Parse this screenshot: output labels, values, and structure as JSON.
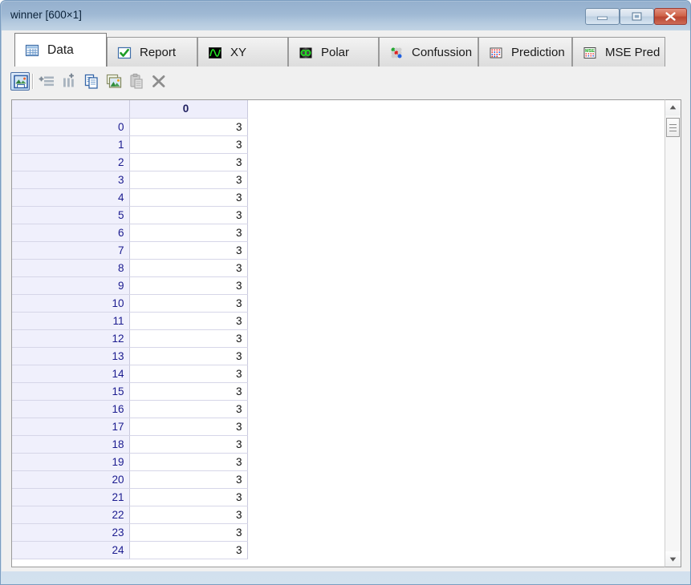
{
  "window": {
    "title": "winner [600×1]",
    "controls": {
      "minimize": "Minimize",
      "maximize": "Maximize",
      "close": "Close"
    }
  },
  "tabs": [
    {
      "label": "Data",
      "icon": "table-grid-icon",
      "active": true
    },
    {
      "label": "Report",
      "icon": "green-check-icon",
      "active": false
    },
    {
      "label": "XY",
      "icon": "waveform-plot-icon",
      "active": false
    },
    {
      "label": "Polar",
      "icon": "polar-plot-icon",
      "active": false
    },
    {
      "label": "Confussion",
      "icon": "confusion-matrix-icon",
      "active": false
    },
    {
      "label": "Prediction",
      "icon": "prediction-grid-icon",
      "active": false
    },
    {
      "label": "MSE Pred",
      "icon": "mse-grid-icon",
      "active": false
    }
  ],
  "toolbar": [
    {
      "name": "save-image-button",
      "icon": "image-save-icon",
      "enabled": true,
      "selected": true
    },
    {
      "name": "add-row-button",
      "icon": "add-row-icon",
      "enabled": true,
      "selected": false
    },
    {
      "name": "add-column-button",
      "icon": "add-column-icon",
      "enabled": true,
      "selected": false
    },
    {
      "name": "copy-button",
      "icon": "copy-icon",
      "enabled": true,
      "selected": false
    },
    {
      "name": "paste-image-button",
      "icon": "paste-image-icon",
      "enabled": true,
      "selected": false
    },
    {
      "name": "paste-button",
      "icon": "clipboard-paste-icon",
      "enabled": false,
      "selected": false
    },
    {
      "name": "delete-button",
      "icon": "delete-x-icon",
      "enabled": true,
      "selected": false
    }
  ],
  "table": {
    "corner_label": "",
    "columns": [
      "0"
    ],
    "rows": [
      {
        "header": "0",
        "values": [
          "3"
        ]
      },
      {
        "header": "1",
        "values": [
          "3"
        ]
      },
      {
        "header": "2",
        "values": [
          "3"
        ]
      },
      {
        "header": "3",
        "values": [
          "3"
        ]
      },
      {
        "header": "4",
        "values": [
          "3"
        ]
      },
      {
        "header": "5",
        "values": [
          "3"
        ]
      },
      {
        "header": "6",
        "values": [
          "3"
        ]
      },
      {
        "header": "7",
        "values": [
          "3"
        ]
      },
      {
        "header": "8",
        "values": [
          "3"
        ]
      },
      {
        "header": "9",
        "values": [
          "3"
        ]
      },
      {
        "header": "10",
        "values": [
          "3"
        ]
      },
      {
        "header": "11",
        "values": [
          "3"
        ]
      },
      {
        "header": "12",
        "values": [
          "3"
        ]
      },
      {
        "header": "13",
        "values": [
          "3"
        ]
      },
      {
        "header": "14",
        "values": [
          "3"
        ]
      },
      {
        "header": "15",
        "values": [
          "3"
        ]
      },
      {
        "header": "16",
        "values": [
          "3"
        ]
      },
      {
        "header": "17",
        "values": [
          "3"
        ]
      },
      {
        "header": "18",
        "values": [
          "3"
        ]
      },
      {
        "header": "19",
        "values": [
          "3"
        ]
      },
      {
        "header": "20",
        "values": [
          "3"
        ]
      },
      {
        "header": "21",
        "values": [
          "3"
        ]
      },
      {
        "header": "22",
        "values": [
          "3"
        ]
      },
      {
        "header": "23",
        "values": [
          "3"
        ]
      },
      {
        "header": "24",
        "values": [
          "3"
        ]
      }
    ]
  },
  "scrollbar": {
    "up_arrow": "scroll-up",
    "down_arrow": "scroll-down",
    "thumb": "scroll-thumb"
  },
  "colors": {
    "titlebar_top": "#95b0ce",
    "titlebar_bottom": "#c2d4e4",
    "close_button": "#ba4632",
    "row_header_bg": "#f0f0fc",
    "row_header_text": "#1b1b8f",
    "tab_active_bg": "#ffffff",
    "toolbar_bg": "#f0f0f0"
  }
}
